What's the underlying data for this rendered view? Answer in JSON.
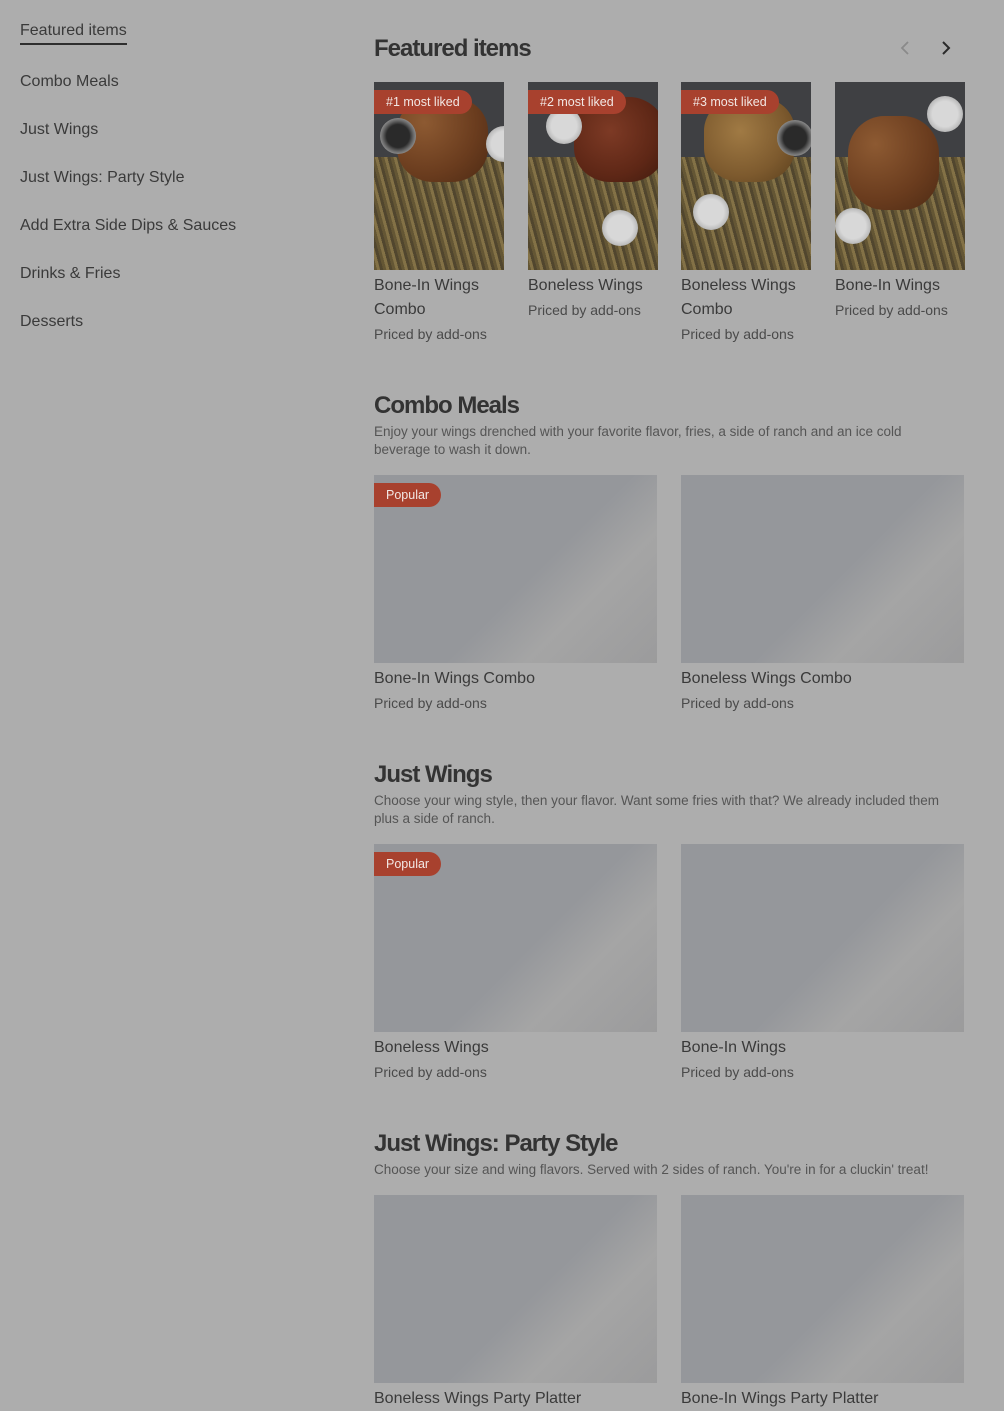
{
  "sidebar": {
    "items": [
      {
        "label": "Featured items"
      },
      {
        "label": "Combo Meals"
      },
      {
        "label": "Just Wings"
      },
      {
        "label": "Just Wings: Party Style"
      },
      {
        "label": "Add Extra Side Dips & Sauces"
      },
      {
        "label": "Drinks & Fries"
      },
      {
        "label": "Desserts"
      }
    ]
  },
  "featured": {
    "title": "Featured items",
    "prev_icon": "chevron-left-icon",
    "next_icon": "chevron-right-icon",
    "items": [
      {
        "badge": "#1 most liked",
        "name": "Bone-In Wings Combo",
        "price": "Priced by add-ons"
      },
      {
        "badge": "#2 most liked",
        "name": "Boneless Wings",
        "price": "Priced by add-ons"
      },
      {
        "badge": "#3 most liked",
        "name": "Boneless Wings Combo",
        "price": "Priced by add-ons"
      },
      {
        "badge": "",
        "name": "Bone-In Wings",
        "price": "Priced by add-ons"
      }
    ]
  },
  "combo": {
    "title": "Combo Meals",
    "description": "Enjoy your wings drenched with your favorite flavor, fries, a side of ranch and an ice cold beverage to wash it down.",
    "items": [
      {
        "badge": "Popular",
        "name": "Bone-In Wings Combo",
        "price": "Priced by add-ons"
      },
      {
        "badge": "",
        "name": "Boneless Wings Combo",
        "price": "Priced by add-ons"
      }
    ]
  },
  "just_wings": {
    "title": "Just Wings",
    "description": "Choose your wing style, then your flavor. Want some fries with that? We already included them plus a side of ranch.",
    "items": [
      {
        "badge": "Popular",
        "name": "Boneless Wings",
        "price": "Priced by add-ons"
      },
      {
        "badge": "",
        "name": "Bone-In Wings",
        "price": "Priced by add-ons"
      }
    ]
  },
  "party": {
    "title": "Just Wings: Party Style",
    "description": "Choose your size and wing flavors. Served with 2 sides of ranch. You're in for a cluckin' treat!",
    "items": [
      {
        "name": "Boneless Wings Party Platter"
      },
      {
        "name": "Bone-In Wings Party Platter"
      }
    ]
  },
  "colors": {
    "background": "#adadad",
    "badge": "#a8412e"
  }
}
